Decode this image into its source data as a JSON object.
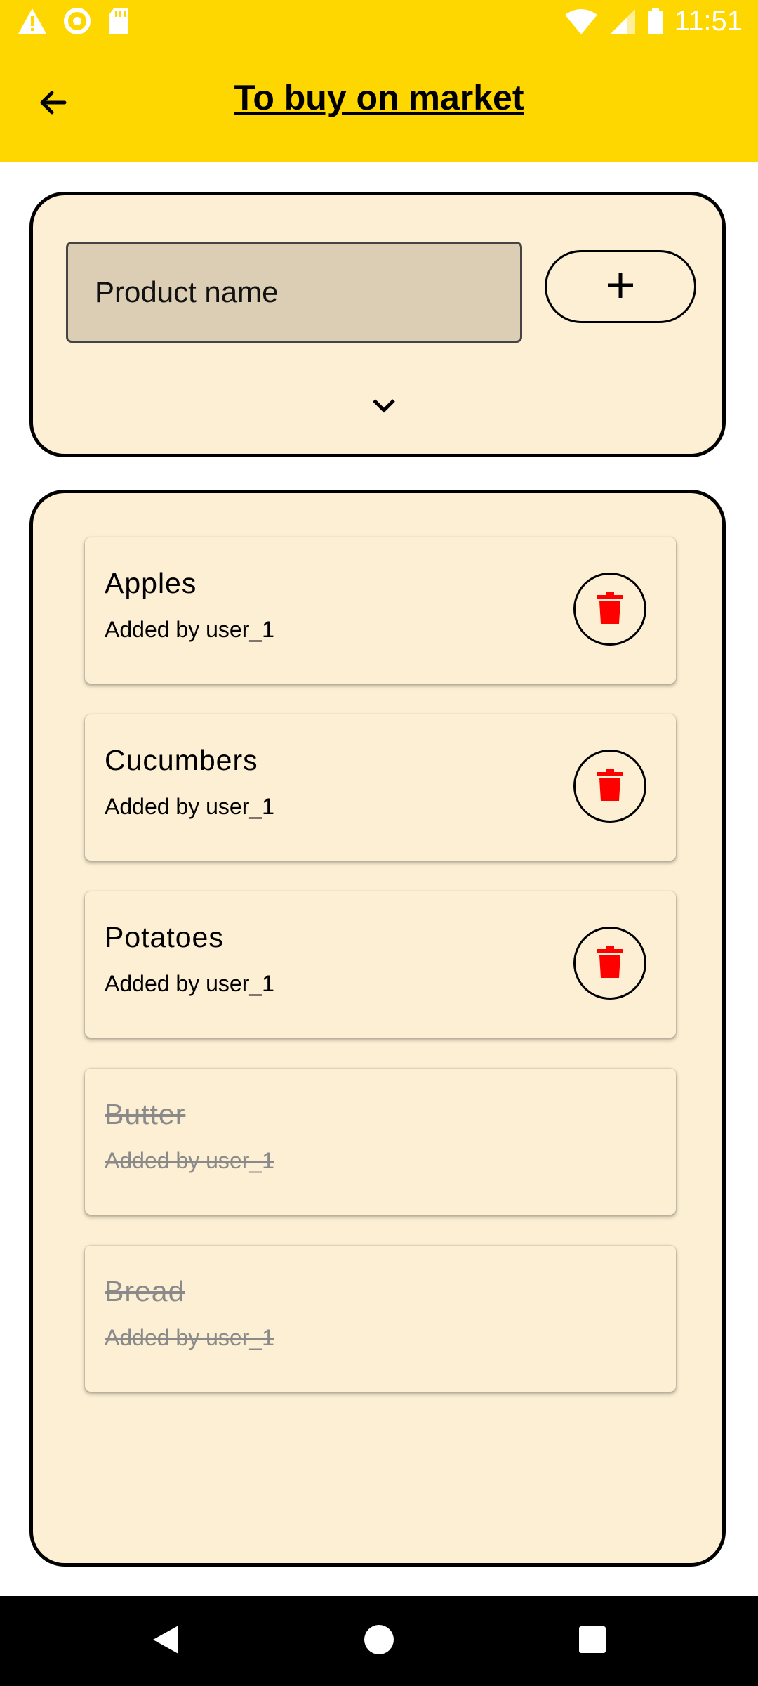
{
  "status_bar": {
    "time": "11:51",
    "left_icons": [
      "warning-icon",
      "circle-notification-icon",
      "sd-card-icon"
    ],
    "right_icons": [
      "wifi-icon",
      "cell-signal-icon",
      "battery-icon"
    ]
  },
  "app_bar": {
    "title": "To buy on market",
    "back_icon": "arrow-back-icon"
  },
  "add_form": {
    "placeholder": "Product name",
    "value": "",
    "add_button_icon": "plus-icon",
    "expand_icon": "chevron-down-icon"
  },
  "items": [
    {
      "name": "Apples",
      "added_by": "Added by user_1",
      "purchased": false
    },
    {
      "name": "Cucumbers",
      "added_by": "Added by user_1",
      "purchased": false
    },
    {
      "name": "Potatoes",
      "added_by": "Added by user_1",
      "purchased": false
    },
    {
      "name": "Butter",
      "added_by": "Added by user_1",
      "purchased": true
    },
    {
      "name": "Bread",
      "added_by": "Added by user_1",
      "purchased": true
    }
  ],
  "colors": {
    "app_bar": "#FFD700",
    "card_background": "#FCEFD4",
    "input_background": "#DCCEB4",
    "delete_icon": "#FF0000",
    "purchased_text": "#8A8A8A"
  },
  "nav_bar": {
    "icons": [
      "back-triangle-icon",
      "home-circle-icon",
      "recents-square-icon"
    ]
  }
}
